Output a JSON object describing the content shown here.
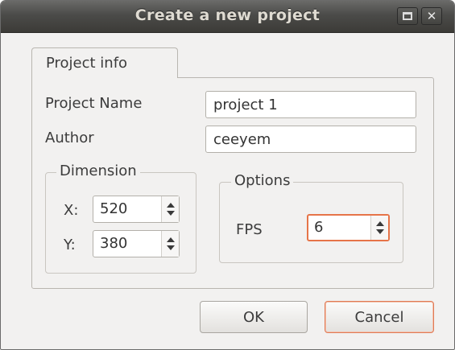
{
  "window": {
    "title": "Create a new project",
    "maximize_icon": "maximize-icon",
    "close_icon": "close-icon"
  },
  "tabs": [
    {
      "label": "Project info",
      "active": true
    }
  ],
  "form": {
    "project_name_label": "Project Name",
    "project_name_value": "project 1",
    "author_label": "Author",
    "author_value": "ceeyem"
  },
  "dimension": {
    "title": "Dimension",
    "x_label": "X:",
    "x_value": "520",
    "y_label": "Y:",
    "y_value": "380"
  },
  "options": {
    "title": "Options",
    "fps_label": "FPS",
    "fps_value": "6"
  },
  "buttons": {
    "ok_label": "OK",
    "cancel_label": "Cancel"
  },
  "colors": {
    "focus_accent": "#e67448",
    "titlebar": "#3c3b37"
  }
}
